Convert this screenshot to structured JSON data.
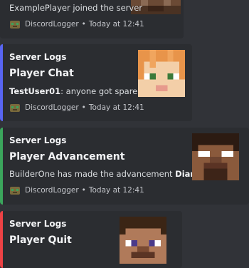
{
  "messages": [
    {
      "description": "ExamplePlayer joined the server",
      "footer_name": "DiscordLogger",
      "footer_time": "Today at 12:41"
    },
    {
      "author": "Server Logs",
      "title": "Player Chat",
      "desc_user": "TestUser01",
      "desc_text": ": anyone got spare iron?",
      "footer_name": "DiscordLogger",
      "footer_time": "Today at 12:41"
    },
    {
      "author": "Server Logs",
      "title": "Player Advancement",
      "desc_text": "BuilderOne has made the advancement ",
      "desc_strong": "Diamonds!",
      "footer_name": "DiscordLogger",
      "footer_time": "Today at 12:41"
    },
    {
      "author": "Server Logs",
      "title": "Player Quit"
    }
  ],
  "colors": {
    "background": "#313338",
    "embed": "#2b2d31",
    "chat_accent": "#5865f2",
    "advancement_accent": "#3ba55c",
    "quit_accent": "#ed4245"
  },
  "footer_separator": "•"
}
